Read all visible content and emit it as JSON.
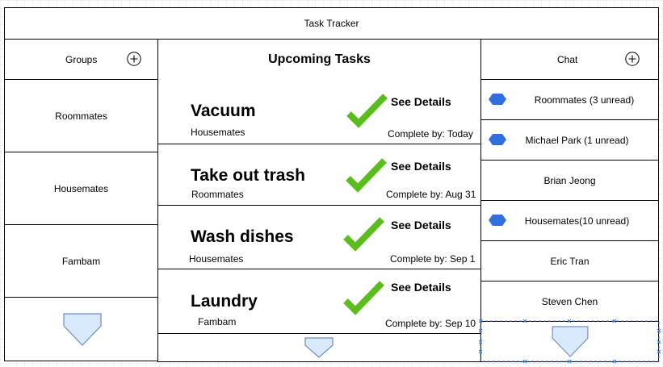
{
  "app": {
    "title": "Task Tracker"
  },
  "groups": {
    "header": "Groups",
    "add_icon": "plus-circle-icon",
    "items": [
      "Roommates",
      "Housemates",
      "Fambam"
    ],
    "more_icon": "triangle-down-icon"
  },
  "tasks": {
    "header": "Upcoming Tasks",
    "items": [
      {
        "title": "Vacuum",
        "group": "Housemates",
        "details": "See Details",
        "due": "Complete by: Today"
      },
      {
        "title": "Take out trash",
        "group": "Roommates",
        "details": "See Details",
        "due": "Complete by: Aug 31"
      },
      {
        "title": "Wash dishes",
        "group": "Housemates",
        "details": "See Details",
        "due": "Complete by: Sep 1"
      },
      {
        "title": "Laundry",
        "group": "Fambam",
        "details": "See Details",
        "due": "Complete by: Sep 10"
      }
    ],
    "check_icon": "checkmark-icon",
    "more_icon": "triangle-down-icon"
  },
  "chat": {
    "header": "Chat",
    "add_icon": "plus-circle-icon",
    "items": [
      {
        "label": "Roommates (3 unread)",
        "unread": true
      },
      {
        "label": "Michael Park (1 unread)",
        "unread": true
      },
      {
        "label": "Brian Jeong",
        "unread": false
      },
      {
        "label": "Housemates(10 unread)",
        "unread": true
      },
      {
        "label": "Eric Tran",
        "unread": false
      },
      {
        "label": "Steven Chen",
        "unread": false
      }
    ],
    "more_icon": "triangle-down-icon"
  },
  "colors": {
    "check": "#5bbd1d",
    "unread_dot": "#2f6fe0",
    "triangle_fill": "#dae8fc",
    "triangle_stroke": "#6c8ebf",
    "selection": "#3b7bd6"
  }
}
